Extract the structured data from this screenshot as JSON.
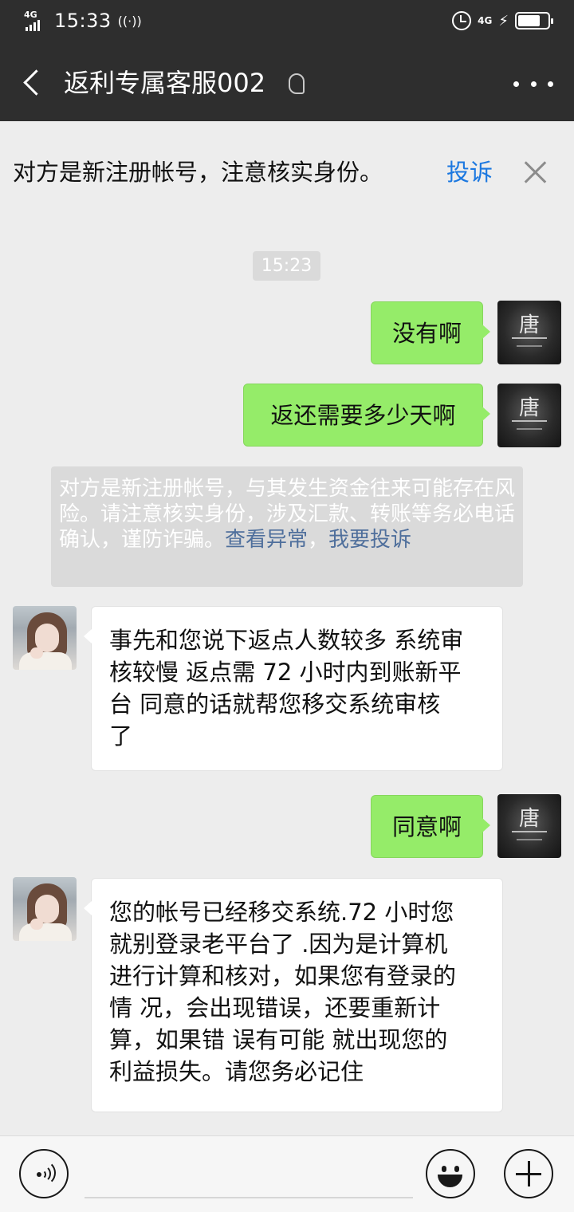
{
  "status_bar": {
    "network_left": "4G",
    "time": "15:33",
    "network_right": "4G",
    "battery_level": 0.75
  },
  "chat": {
    "title": "返利专属客服002"
  },
  "warning_banner": {
    "text": "对方是新注册帐号，注意核实身份。",
    "action": "投诉"
  },
  "timestamp": "15:23",
  "messages": [
    {
      "sender": "me",
      "text": "没有啊"
    },
    {
      "sender": "me",
      "text": "返还需要多少天啊"
    },
    {
      "sender": "system",
      "text": "对方是新注册帐号，与其发生资金往来可能存在风险。请注意核实身份，涉及汇款、转账等务必电话确认，谨防诈骗。",
      "link1": "查看异常",
      "separator": "，",
      "link2": "我要投诉"
    },
    {
      "sender": "other",
      "lines": [
        "事先和您说下返点人数较多 系统审",
        "核较慢 返点需 72 小时内到账新平",
        "台 同意的话就帮您移交系统审核",
        "了"
      ]
    },
    {
      "sender": "me",
      "text": "同意啊"
    },
    {
      "sender": "other",
      "lines": [
        "您的帐号已经移交系统.72 小时您",
        "就别登录老平台了 .因为是计算机",
        "进行计算和核对，如果您有登录的",
        "情 况，会出现错误，还要重新计",
        "算，如果错 误有可能 就出现您的",
        "利益损失。请您务必记住"
      ]
    }
  ],
  "avatar_me_glyph": "唐"
}
